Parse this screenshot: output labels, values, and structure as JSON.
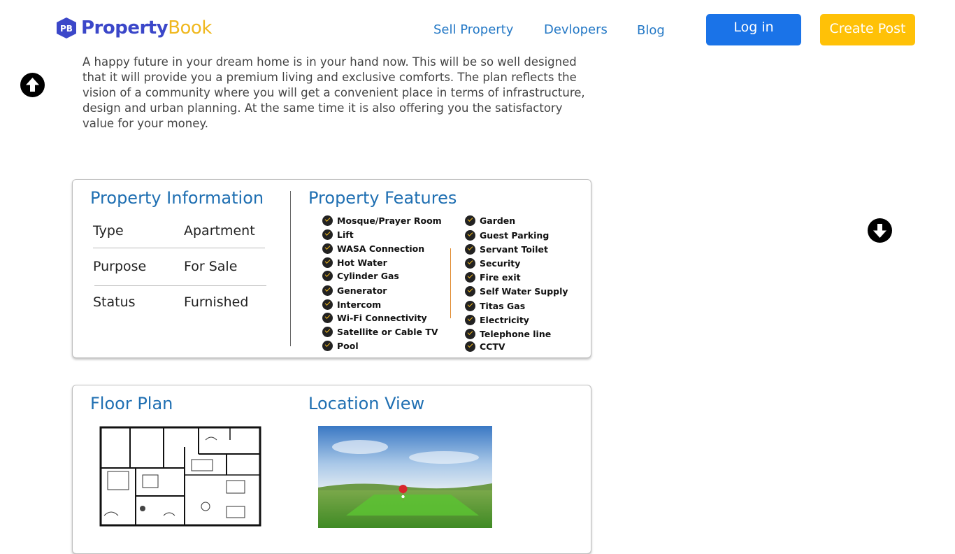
{
  "header": {
    "logo": {
      "part1": "Property",
      "part2": "Book"
    },
    "nav": [
      "Sell Property",
      "Devlopers",
      "Blog"
    ],
    "login_label": "Log in",
    "create_post_label": "Create Post"
  },
  "description": "A happy future in your dream home is in your hand now. This will be so well designed that it will provide you a premium living and exclusive comforts. The plan reflects the vision of a community where you will get a convenient place in terms of infrastructure, design and urban planning. At the same time it is also offering you the satisfactory value for your money.",
  "property_info": {
    "title": "Property Information",
    "rows": [
      {
        "label": "Type",
        "value": "Apartment"
      },
      {
        "label": "Purpose",
        "value": "For Sale"
      },
      {
        "label": "Status",
        "value": "Furnished"
      }
    ]
  },
  "property_features": {
    "title": "Property Features",
    "left": [
      "Mosque/Prayer Room",
      "Lift",
      "WASA Connection",
      "Hot Water",
      "Cylinder Gas",
      "Generator",
      "Intercom",
      "Wi-Fi Connectivity",
      "Satellite or Cable TV",
      "Pool"
    ],
    "right": [
      "Garden",
      "Guest Parking",
      "Servant Toilet",
      "Security",
      "Fire exit",
      "Self Water Supply",
      "Titas Gas",
      "Electricity",
      "Telephone line",
      "CCTV"
    ]
  },
  "floor_plan": {
    "title": "Floor Plan"
  },
  "location_view": {
    "title": "Location View"
  },
  "icons": {
    "scroll_up": "arrow-up-circle-icon",
    "scroll_down": "arrow-down-circle-icon",
    "check": "check-circle-icon"
  },
  "colors": {
    "brand_blue": "#3b47c9",
    "brand_yellow": "#f0b81f",
    "login_blue": "#1a73e8",
    "post_yellow": "#ffc107",
    "title_blue": "#1f6fb2",
    "nav_blue": "#2579c6"
  }
}
